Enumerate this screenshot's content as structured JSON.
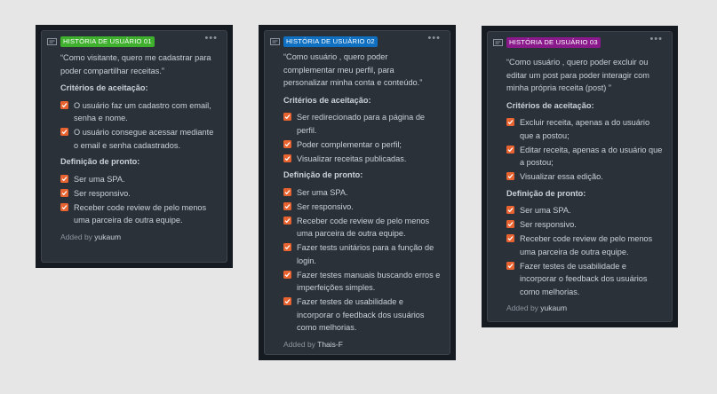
{
  "colors": {
    "badge_green": "#3fb02e",
    "badge_blue": "#0f6fc0",
    "badge_purple": "#8a1a8c",
    "checkbox": "#e8632f"
  },
  "cards": [
    {
      "badge": "HISTÓRIA DE USUÁRIO 01",
      "quote": "“Como visitante, quero me cadastrar para poder compartilhar receitas.”",
      "acceptance_title": "Critérios de aceitação:",
      "acceptance": [
        "O usuário faz um cadastro com email, senha e nome.",
        "O usuário consegue acessar mediante o email e senha cadastrados."
      ],
      "done_title": "Definição de pronto:",
      "done": [
        "Ser uma SPA.",
        "Ser responsivo.",
        "Receber code review de pelo menos uma parceira de outra equipe."
      ],
      "added_prefix": "Added by",
      "author": "yukaum"
    },
    {
      "badge": "HISTÓRIA DE USUÁRIO 02",
      "quote": "“Como usuário , quero poder complementar meu perfil, para personalizar minha conta e conteúdo.”",
      "acceptance_title": "Critérios de aceitação:",
      "acceptance": [
        "Ser redirecionado para a página de perfil.",
        "Poder complementar o perfil;",
        "Visualizar receitas publicadas."
      ],
      "done_title": "Definição de pronto:",
      "done": [
        "Ser uma SPA.",
        "Ser responsivo.",
        "Receber code review de pelo menos uma parceira de outra equipe.",
        "Fazer tests unitários para a função de login.",
        "Fazer testes manuais buscando erros e imperfeições simples.",
        "Fazer testes de usabilidade e incorporar o feedback dos usuários como melhorias."
      ],
      "added_prefix": "Added by",
      "author": "Thais-F"
    },
    {
      "badge": "HISTÓRIA DE USUÁRIO 03",
      "quote": "“Como usuário , quero poder excluir ou editar um post para poder interagir com minha própria receita (post) ”",
      "acceptance_title": "Critérios de aceitação:",
      "acceptance": [
        "Excluir receita, apenas a do usuário que a postou;",
        "Editar receita, apenas a do usuário que a postou;",
        "Visualizar essa edição."
      ],
      "done_title": "Definição de pronto:",
      "done": [
        "Ser uma SPA.",
        "Ser responsivo.",
        "Receber code review de pelo menos uma parceira de outra equipe.",
        "Fazer testes de usabilidade e incorporar o feedback dos usuários como melhorias."
      ],
      "added_prefix": "Added by",
      "author": "yukaum"
    }
  ]
}
